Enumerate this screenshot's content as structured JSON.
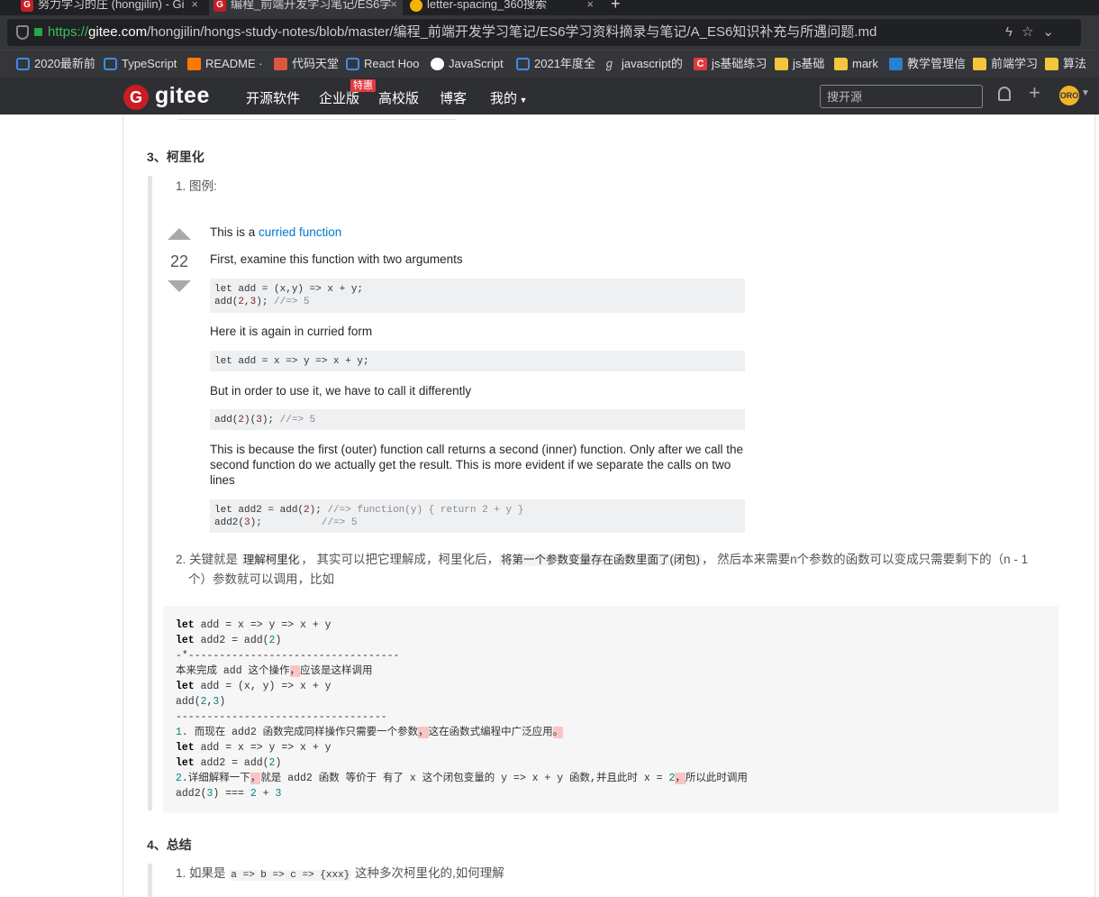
{
  "browser": {
    "tabs": [
      {
        "title": "努力学习的庄 (hongjilin) - Gi",
        "active": false
      },
      {
        "title": "编程_前端开发学习笔记/ES6学",
        "active": true
      },
      {
        "title": "letter-spacing_360搜索",
        "active": false
      }
    ],
    "url_scheme": "https://",
    "url_host": "gitee.com",
    "url_path": "/hongjilin/hongs-study-notes/blob/master/编程_前端开发学习笔记/ES6学习资料摘录与笔记/A_ES6知识补充与所遇问题.md",
    "bookmarks": [
      "2020最新前",
      "TypeScript",
      "README ·",
      "代码天堂",
      "React Hoo",
      "JavaScript",
      "2021年度全",
      "javascript的",
      "js基础练习",
      "js基础",
      "mark",
      "教学管理信",
      "前端学习",
      "算法"
    ]
  },
  "gitee": {
    "logo_text": "gitee",
    "nav": [
      "开源软件",
      "企业版",
      "高校版",
      "博客",
      "我的"
    ],
    "badge": "特惠",
    "search_placeholder": "搜开源",
    "avatar_text": "ORO"
  },
  "doc": {
    "section3_title": "3、柯里化",
    "item1": "1. 图例:",
    "screenshot": {
      "votes": "22",
      "p1_pre": "This is a ",
      "p1_link": "curried function",
      "p2": "First, examine this function with two arguments",
      "code1_l1": "let add = (x,y) => x + y;",
      "code1_l2a": "add(",
      "code1_l2b": "2,3",
      "code1_l2c": "); ",
      "code1_l2d": "//=> 5",
      "p3": "Here it is again in curried form",
      "code2": "let add = x => y => x + y;",
      "p4": "But in order to use it, we have to call it differently",
      "code3a": "add(",
      "code3b": "2",
      "code3c": ")(",
      "code3d": "3",
      "code3e": "); ",
      "code3f": "//=> 5",
      "p5": "This is because the first (outer) function call returns a second (inner) function. Only after we call the second function do we actually get the result. This is more evident if we separate the calls on two lines",
      "code4_l1a": "let add2 = add(",
      "code4_l1b": "2",
      "code4_l1c": "); ",
      "code4_l1d": "//=> function(y) { return 2 + y }",
      "code4_l2a": "add2(",
      "code4_l2b": "3",
      "code4_l2c": ");          ",
      "code4_l2d": "//=> 5"
    },
    "item2_pre": "2. 关键就是 ",
    "item2_hl1": "理解柯里化",
    "item2_mid": "， 其实可以把它理解成，柯里化后，",
    "item2_hl2": "将第一个参数变量存在函数里面了(闭包)",
    "item2_post": "， 然后本来需要n个参数的函数可以变成只需要剩下的（n - 1",
    "item2_line2": "个）参数就可以调用，比如",
    "code": {
      "l1": "add = x => y => x + y",
      "l2a": "add2 = add(",
      "l2b": "2",
      "l2c": ")",
      "l3": "-*----------------------------------",
      "l4a": "本来完成 add 这个操作",
      "l4b": "，",
      "l4c": "应该是这样调用",
      "l5": "add = (x, y) => x + y",
      "l6a": "add(",
      "l6b": "2",
      "l6c": ",",
      "l6d": "3",
      "l6e": ")",
      "l7": "----------------------------------",
      "l8a": "1",
      "l8b": ". 而现在 add2 函数完成同样操作只需要一个参数",
      "l8c": "，",
      "l8d": "这在函数式编程中广泛应用",
      "l8e": "。",
      "l9": "add = x => y => x + y",
      "l10a": "add2 = add(",
      "l10b": "2",
      "l10c": ")",
      "l11a": "2",
      "l11b": ".详细解释一下",
      "l11c": "，",
      "l11d": "就是 add2 函数 等价于 有了 x 这个闭包变量的 y => x + y 函数,并且此时 x = ",
      "l11e": "2",
      "l11f": "，",
      "l11g": "所以此时调用",
      "l12a": "add2(",
      "l12b": "3",
      "l12c": ") === ",
      "l12d": "2",
      "l12e": " + ",
      "l12f": "3",
      "kw": "let"
    },
    "section4_title": "4、总结",
    "s4_item1_pre": "1. 如果是 ",
    "s4_item1_code": "a => b => c => {xxx}",
    "s4_item1_post": " 这种多次柯里化的,如何理解"
  }
}
